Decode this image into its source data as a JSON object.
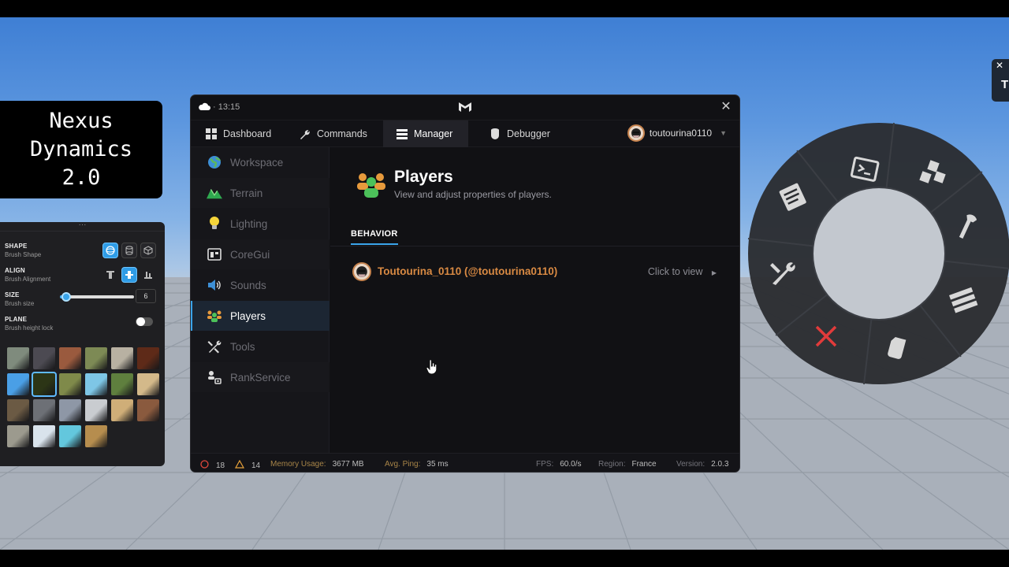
{
  "title_card": {
    "line1": "Nexus",
    "line2": "Dynamics",
    "line3": "2.0"
  },
  "terrain_tools": {
    "grip": "···",
    "shape": {
      "label": "SHAPE",
      "sub": "Brush Shape"
    },
    "align": {
      "label": "ALIGN",
      "sub": "Brush Alignment"
    },
    "size": {
      "label": "SIZE",
      "sub": "Brush size",
      "value": "6",
      "fraction": 0.08
    },
    "plane": {
      "label": "PLANE",
      "sub": "Brush height lock"
    },
    "materials": [
      "#7f8b7d",
      "#4c4a52",
      "#9a5a3e",
      "#7d8a55",
      "#b8b1a2",
      "#5e2a18",
      "#4a9fe6",
      "#2c3516",
      "#7f8a4a",
      "#7ec6e6",
      "#5f7f3e",
      "#d3b98a",
      "#6b5a44",
      "#6d7076",
      "#8e97a6",
      "#c9ccd0",
      "#cfae78",
      "#8a5a3e",
      "#9c9a8e",
      "#d9e3ec",
      "#63c7dd",
      "#b68d4e"
    ]
  },
  "window": {
    "time": "13:15",
    "time_prefix": "·",
    "close": "✕",
    "tabs": [
      {
        "label": "Dashboard"
      },
      {
        "label": "Commands"
      },
      {
        "label": "Manager"
      },
      {
        "label": "Debugger"
      }
    ],
    "user": {
      "name": "toutourina0110"
    },
    "sidebar": [
      {
        "label": "Workspace"
      },
      {
        "label": "Terrain"
      },
      {
        "label": "Lighting"
      },
      {
        "label": "CoreGui"
      },
      {
        "label": "Sounds"
      },
      {
        "label": "Players"
      },
      {
        "label": "Tools"
      },
      {
        "label": "RankService"
      }
    ],
    "page": {
      "title": "Players",
      "subtitle": "View and adjust properties of players.",
      "section": "BEHAVIOR",
      "player": {
        "name": "Toutourina_0110 (@toutourina0110)",
        "action": "Click to view"
      }
    },
    "status": {
      "errors": "18",
      "warnings": "14",
      "memory_label": "Memory Usage:",
      "memory_value": "3677 MB",
      "ping_label": "Avg. Ping:",
      "ping_value": "35 ms",
      "fps_label": "FPS:",
      "fps_value": "60.0/s",
      "region_label": "Region:",
      "region_value": "France",
      "version_label": "Version:",
      "version_value": "2.0.3"
    }
  },
  "edge_widget": {
    "close": "✕",
    "icon": "T"
  },
  "colors": {
    "accent": "#3aa4ea",
    "player_name": "#d98a43",
    "status_key": "#a88548",
    "window_bg": "#111114"
  }
}
